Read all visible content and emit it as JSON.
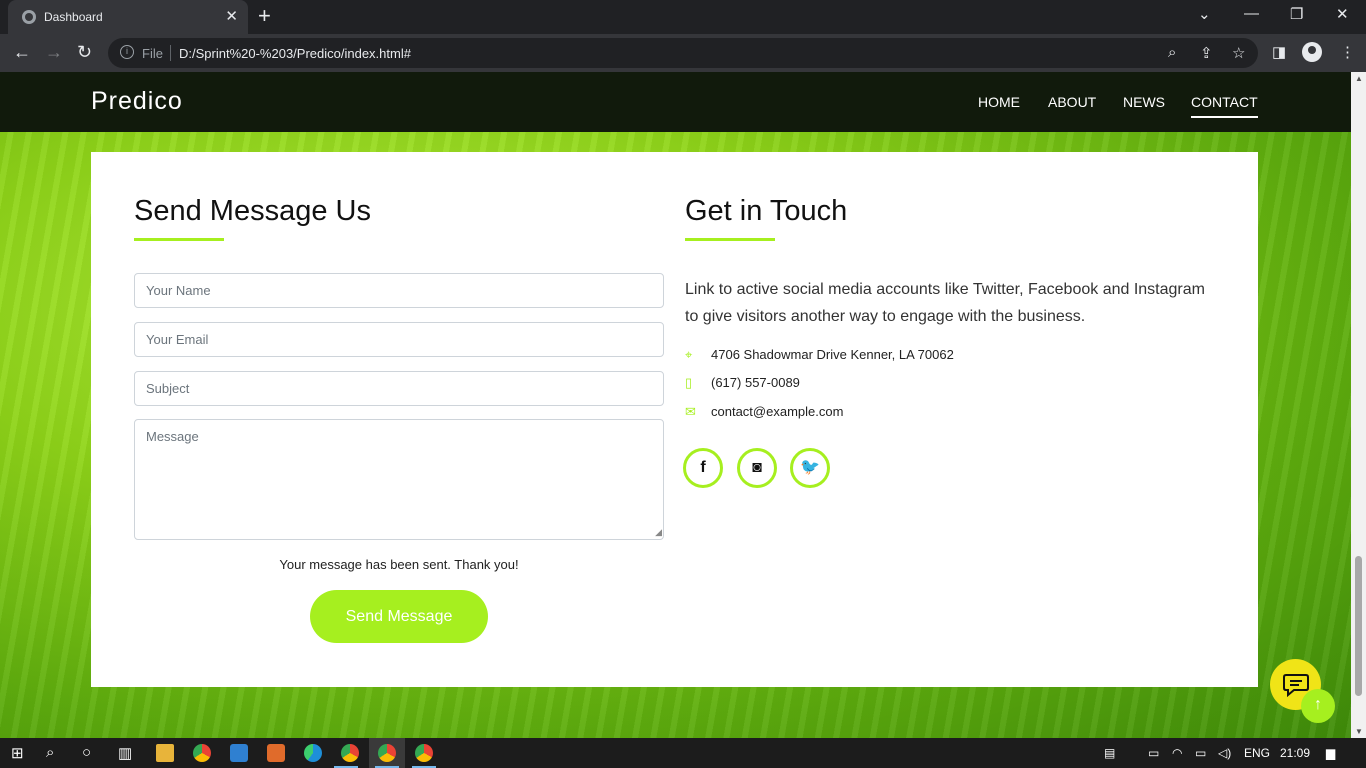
{
  "browser": {
    "tab_title": "Dashboard",
    "url_scheme": "File",
    "url": "D:/Sprint%20-%203/Predico/index.html#"
  },
  "site": {
    "logo": "Predico",
    "nav": [
      "HOME",
      "ABOUT",
      "NEWS",
      "CONTACT"
    ],
    "active_nav": "CONTACT"
  },
  "form": {
    "heading": "Send Message Us",
    "name_placeholder": "Your Name",
    "email_placeholder": "Your Email",
    "subject_placeholder": "Subject",
    "message_placeholder": "Message",
    "sent_message": "Your message has been sent. Thank you!",
    "submit_label": "Send Message"
  },
  "contact": {
    "heading": "Get in Touch",
    "description": "Link to active social media accounts like Twitter, Facebook and Instagram to give visitors another way to engage with the business.",
    "address": "4706 Shadowmar Drive Kenner, LA 70062",
    "phone": "(617) 557-0089",
    "email": "contact@example.com",
    "socials": [
      "facebook-icon",
      "instagram-icon",
      "twitter-icon"
    ]
  },
  "taskbar": {
    "language": "ENG",
    "time": "21:09"
  },
  "colors": {
    "accent": "#a6ef1f",
    "header_bg": "#111a0c",
    "chat": "#f0e417"
  }
}
